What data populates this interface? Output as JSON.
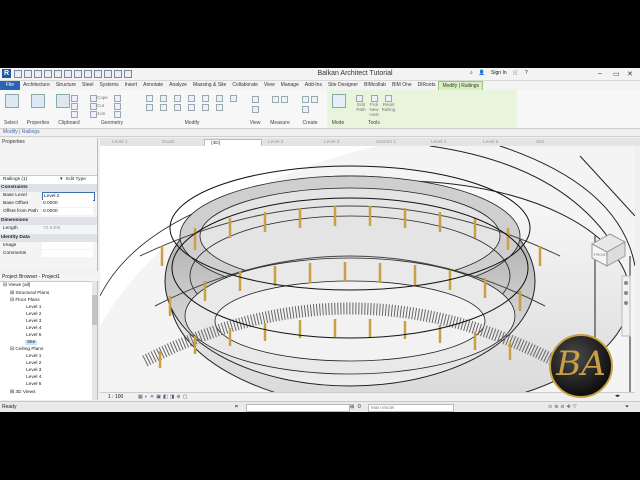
{
  "app": {
    "logo_letter": "R",
    "title": "Balkan Architect Tutorial",
    "sign_in": "Sign In",
    "help": "?"
  },
  "tabs": [
    "File",
    "Architecture",
    "Structure",
    "Steel",
    "Systems",
    "Insert",
    "Annotate",
    "Analyze",
    "Massing & Site",
    "Collaborate",
    "View",
    "Manage",
    "Add-Ins",
    "Site Designer",
    "BIMcollab",
    "BIM One",
    "DiRoots",
    "Modify | Railings"
  ],
  "ribbon": {
    "groups": [
      "Select",
      "Properties",
      "Clipboard",
      "Geometry",
      "Modify",
      "View",
      "Measure",
      "Create",
      "Mode",
      "Tools"
    ],
    "select_label": "Select",
    "properties_label": "Properties",
    "clipboard_items": [
      "Cope",
      "Cut",
      "Join"
    ],
    "tools_items": [
      "Edit Path",
      "Pick New Host",
      "Reset Railing"
    ]
  },
  "modify_bar": "Modify | Railings",
  "properties": {
    "header": "Properties",
    "type_selector": "Railings (1)",
    "edit_type": "Edit Type",
    "sections": [
      {
        "label": "Constraints",
        "rows": [
          {
            "k": "Base Level",
            "v": "Level 2"
          },
          {
            "k": "Base Offset",
            "v": "0.0000"
          },
          {
            "k": "Offset from Path",
            "v": "0.0000"
          }
        ]
      },
      {
        "label": "Dimensions",
        "rows": [
          {
            "k": "Length",
            "v": "72.5409"
          }
        ]
      },
      {
        "label": "Identity Data",
        "rows": [
          {
            "k": "Image",
            "v": ""
          },
          {
            "k": "Comments",
            "v": ""
          }
        ]
      }
    ]
  },
  "browser": {
    "header": "Project Browser - Project1",
    "items": [
      {
        "label": "Views (all)",
        "depth": 0
      },
      {
        "label": "Structural Plans",
        "depth": 1
      },
      {
        "label": "Floor Plans",
        "depth": 1
      },
      {
        "label": "Level 1",
        "depth": 2
      },
      {
        "label": "Level 2",
        "depth": 2
      },
      {
        "label": "Level 3",
        "depth": 2
      },
      {
        "label": "Level 4",
        "depth": 2
      },
      {
        "label": "Level 5",
        "depth": 2
      },
      {
        "label": "Site",
        "depth": 2,
        "selected": true
      },
      {
        "label": "Ceiling Plans",
        "depth": 1
      },
      {
        "label": "Level 1",
        "depth": 2
      },
      {
        "label": "Level 2",
        "depth": 2
      },
      {
        "label": "Level 3",
        "depth": 2
      },
      {
        "label": "Level 4",
        "depth": 2
      },
      {
        "label": "Level 5",
        "depth": 2
      },
      {
        "label": "3D Views",
        "depth": 1
      }
    ]
  },
  "view_tabs": [
    "Level 1",
    "South",
    "{3D}",
    "Level 2",
    "Level 3",
    "Section 1",
    "Level 4",
    "Level 5",
    "Site"
  ],
  "active_view_tab": "{3D}",
  "view_control": {
    "scale": "1 : 100"
  },
  "status": {
    "ready": "Ready",
    "model": "Main Model",
    "zero": "0"
  },
  "view_cube": "FRONT",
  "watermark_letters": "BA",
  "colors": {
    "file_tab": "#2b62b3",
    "context_tab": "#d9f0c0",
    "gold_post": "#c9a043"
  }
}
